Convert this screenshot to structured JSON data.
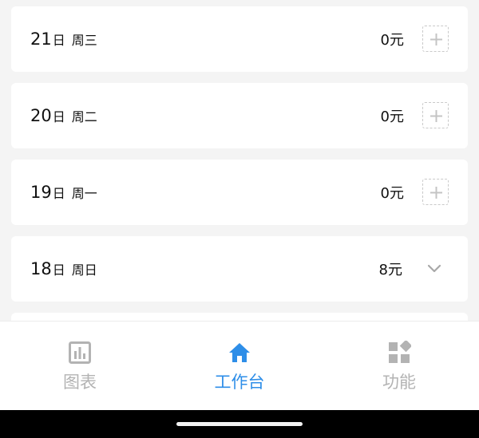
{
  "days": [
    {
      "day": "21",
      "unit": "日",
      "weekday": "周三",
      "amount": "0元",
      "action": "add"
    },
    {
      "day": "20",
      "unit": "日",
      "weekday": "周二",
      "amount": "0元",
      "action": "add"
    },
    {
      "day": "19",
      "unit": "日",
      "weekday": "周一",
      "amount": "0元",
      "action": "add"
    },
    {
      "day": "18",
      "unit": "日",
      "weekday": "周日",
      "amount": "8元",
      "action": "expand"
    }
  ],
  "icons": {
    "add": "plus-icon",
    "expand": "chevron-down-icon",
    "tab_charts": "bar-chart-icon",
    "tab_workbench": "home-icon",
    "tab_functions": "grid-icon"
  },
  "tabs": [
    {
      "label": "图表",
      "active": false
    },
    {
      "label": "工作台",
      "active": true
    },
    {
      "label": "功能",
      "active": false
    }
  ],
  "colors": {
    "accent": "#2e8ee8",
    "inactive": "#b3b3b3",
    "background": "#f4f4f4",
    "card": "#ffffff"
  }
}
